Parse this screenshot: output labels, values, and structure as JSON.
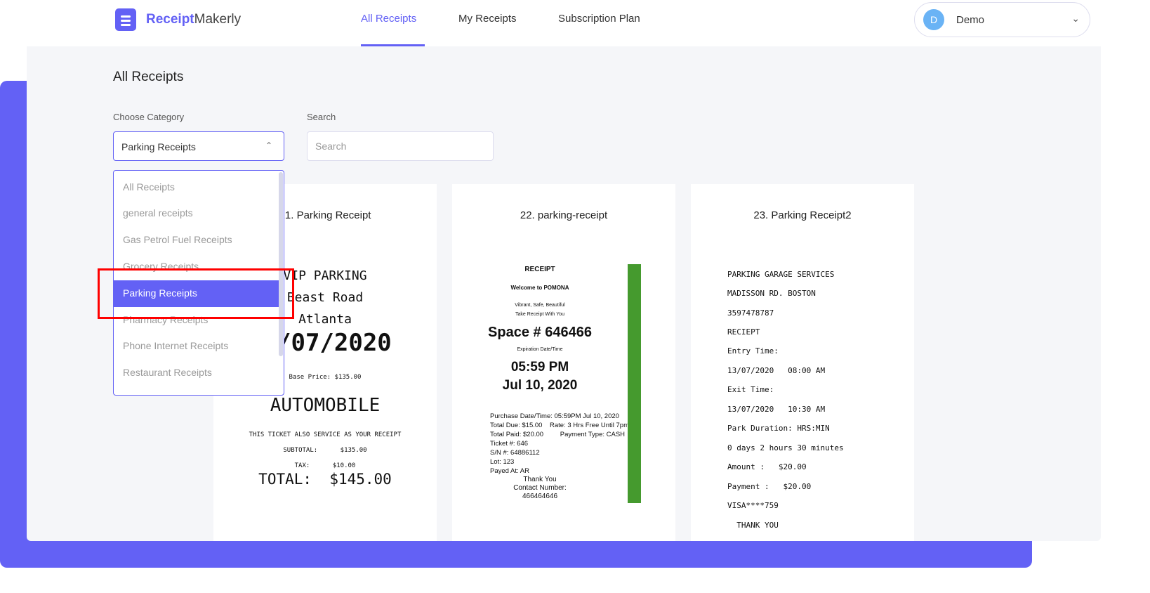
{
  "brand": {
    "part1": "Receipt",
    "part2": "Makerly",
    "accent": "#6361f5"
  },
  "nav": {
    "links": [
      "All Receipts",
      "My Receipts",
      "Subscription Plan"
    ],
    "active": "All Receipts"
  },
  "user": {
    "initial": "D",
    "name": "Demo"
  },
  "page": {
    "title": "All Receipts",
    "category_label": "Choose Category",
    "category_value": "Parking Receipts",
    "search_label": "Search",
    "search_placeholder": "Search"
  },
  "dropdown": {
    "options": [
      "All Receipts",
      "general receipts",
      "Gas Petrol Fuel Receipts",
      "Grocery Receipts",
      "Parking Receipts",
      "Pharmacy Receipts",
      "Phone Internet Receipts",
      "Restaurant Receipts"
    ],
    "selected": "Parking Receipts"
  },
  "cards": [
    {
      "title": "21. Parking Receipt",
      "lines": [
        "VIP PARKING",
        "Beast Road",
        "Atlanta",
        "/07/2020",
        "Base Price: $135.00",
        "AUTOMOBILE",
        "THIS TICKET ALSO SERVICE AS YOUR RECEIPT",
        "SUBTOTAL:      $135.00",
        "TAX:      $10.00",
        "TOTAL:  $145.00"
      ]
    },
    {
      "title": "22. parking-receipt",
      "heading": "RECEIPT",
      "welcome": "Welcome to POMONA",
      "tag1": "Vibrant, Safe, Beautiful",
      "tag2": "Take Receipt With You",
      "space": "Space # 646466",
      "exp_label": "Expiration Date/Time",
      "time": "05:59 PM",
      "date": "Jul 10, 2020",
      "details": [
        "Purchase Date/Time: 05:59PM Jul 10, 2020",
        "Total Due: $15.00    Rate: 3 Hrs Free Until 7pm",
        "Total Paid: $20.00         Payment Type: CASH",
        "Ticket #: 646",
        "S/N #: 64886112",
        "Lot: 123",
        "Payed At: AR"
      ],
      "thanks": "Thank You",
      "contact": "Contact Number:",
      "contact_no": "466464646",
      "bar_color": "#459a2e"
    },
    {
      "title": "23. Parking Receipt2",
      "lines": [
        "PARKING GARAGE SERVICES",
        "MADISSON RD. BOSTON",
        "3597478787",
        "RECIEPT",
        "Entry Time:",
        "13/07/2020   08:00 AM",
        "Exit Time:",
        "13/07/2020   10:30 AM",
        "Park Duration: HRS:MIN",
        "0 days 2 hours 30 minutes",
        "Amount :   $20.00",
        "Payment :   $20.00",
        "VISA****759",
        "  THANK YOU"
      ]
    }
  ]
}
